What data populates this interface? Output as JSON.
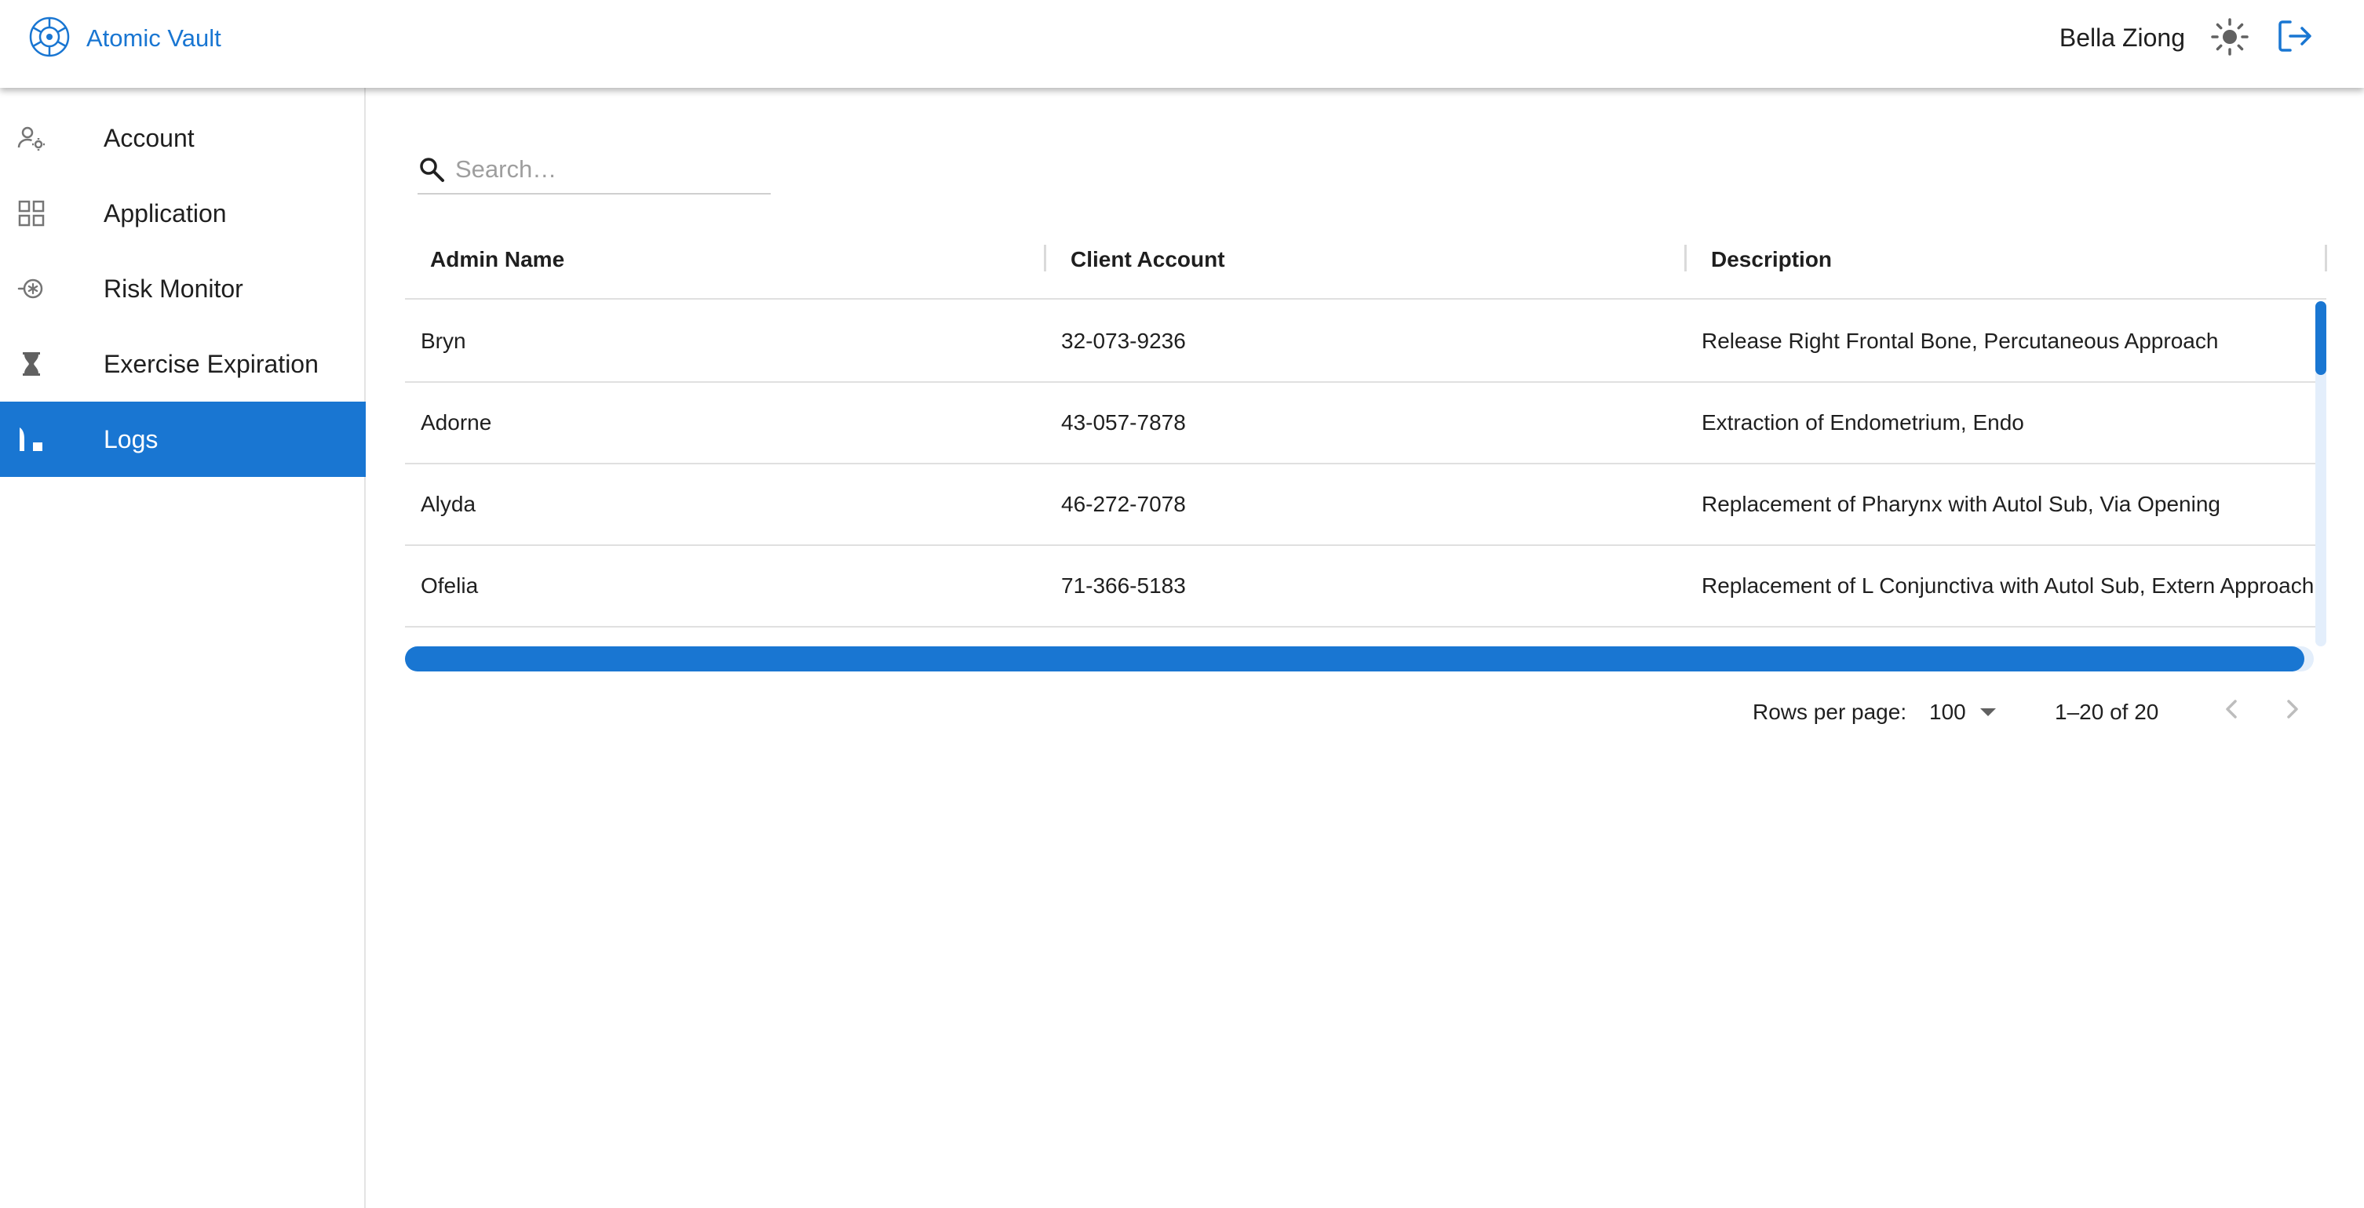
{
  "header": {
    "title": "Atomic Vault",
    "user_name": "Bella Ziong",
    "logo_icon": "atom-logo-icon",
    "theme_icon": "sun-icon",
    "logout_icon": "logout-icon"
  },
  "sidebar": {
    "items": [
      {
        "label": "Account",
        "icon": "user-settings-icon",
        "active": false
      },
      {
        "label": "Application",
        "icon": "grid-icon",
        "active": false
      },
      {
        "label": "Risk Monitor",
        "icon": "risk-icon",
        "active": false
      },
      {
        "label": "Exercise Expiration",
        "icon": "hourglass-icon",
        "active": false
      },
      {
        "label": "Logs",
        "icon": "logs-icon",
        "active": true
      }
    ]
  },
  "search": {
    "placeholder": "Search…",
    "value": ""
  },
  "table": {
    "columns": [
      "Admin Name",
      "Client Account",
      "Description"
    ],
    "rows": [
      {
        "admin": "Bryn",
        "account": "32-073-9236",
        "description": "Release Right Frontal Bone, Percutaneous Approach"
      },
      {
        "admin": "Adorne",
        "account": "43-057-7878",
        "description": "Extraction of Endometrium, Endo"
      },
      {
        "admin": "Alyda",
        "account": "46-272-7078",
        "description": "Replacement of Pharynx with Autol Sub, Via Opening"
      },
      {
        "admin": "Ofelia",
        "account": "71-366-5183",
        "description": "Replacement of L Conjunctiva with Autol Sub, Extern Approach"
      }
    ]
  },
  "pagination": {
    "rows_per_page_label": "Rows per page:",
    "rows_per_page_value": "100",
    "range": "1–20 of 20"
  },
  "colors": {
    "accent": "#1976d2",
    "scroll_track": "#e3eefb",
    "divider": "#e0e0e0"
  }
}
